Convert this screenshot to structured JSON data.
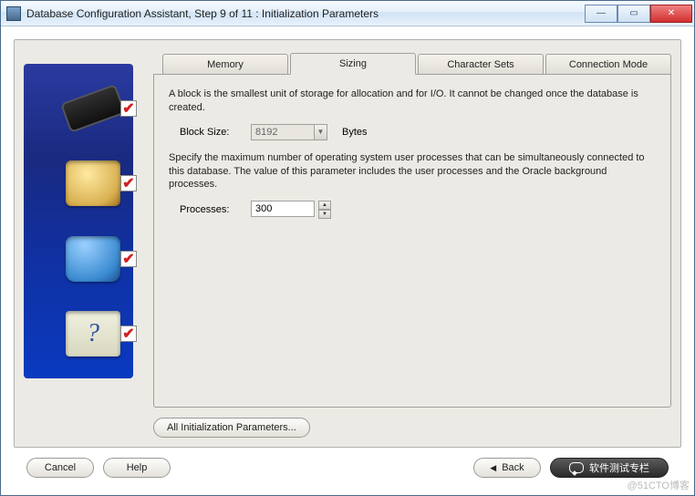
{
  "window": {
    "title": "Database Configuration Assistant, Step 9 of 11 : Initialization Parameters"
  },
  "tabs": {
    "memory": "Memory",
    "sizing": "Sizing",
    "charset": "Character Sets",
    "connmode": "Connection Mode"
  },
  "sizing": {
    "block_desc": "A block is the smallest unit of storage for allocation and for I/O. It cannot be changed once the database is created.",
    "block_label": "Block Size:",
    "block_value": "8192",
    "block_unit": "Bytes",
    "proc_desc": "Specify the maximum number of operating system user processes that can be simultaneously connected to this database. The value of this parameter includes the user processes and the Oracle background processes.",
    "proc_label": "Processes:",
    "proc_value": "300"
  },
  "buttons": {
    "all_params": "All Initialization Parameters...",
    "cancel": "Cancel",
    "help": "Help",
    "back": "Back",
    "next": "软件测试专栏"
  },
  "sidebar": {
    "q_glyph": "?"
  },
  "watermark": "@51CTO博客"
}
